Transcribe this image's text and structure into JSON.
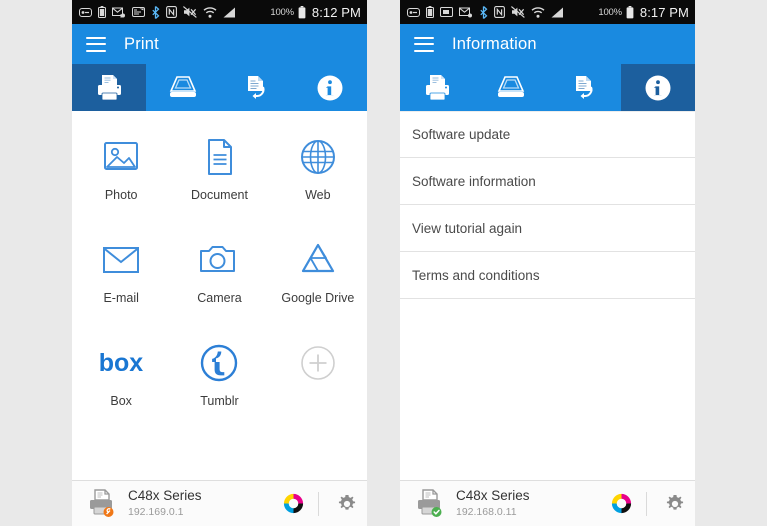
{
  "theme": {
    "accent": "#1a8ae0",
    "accent_dark": "#1c5f9e",
    "icon_blue": "#3f8ddb",
    "status_bg": "#0a0a0a",
    "page_bg": "#e9e9e9",
    "text_primary": "#3c3c3c",
    "text_secondary": "#9a9a9a",
    "ok_green": "#4caf50",
    "warn_orange": "#f07818"
  },
  "left_phone": {
    "status_bar": {
      "icons": [
        "sim-card-icon",
        "battery-saving-icon",
        "mail-sync-icon",
        "sd-card-icon",
        "bluetooth-icon",
        "nfc-icon",
        "mute-icon",
        "wifi-icon",
        "signal-icon"
      ],
      "battery_percent": "100%",
      "battery_icon": "battery-full-icon",
      "time": "8:12 PM"
    },
    "app_bar": {
      "menu_icon": "hamburger-menu-icon",
      "title": "Print"
    },
    "tabs": [
      {
        "name": "print",
        "icon": "printer-icon",
        "active": true
      },
      {
        "name": "scan",
        "icon": "scanner-icon",
        "active": false
      },
      {
        "name": "fax",
        "icon": "fax-document-icon",
        "active": false
      },
      {
        "name": "information",
        "icon": "info-circle-icon",
        "active": false
      }
    ],
    "sources": [
      {
        "label": "Photo",
        "icon": "photo-icon"
      },
      {
        "label": "Document",
        "icon": "document-icon"
      },
      {
        "label": "Web",
        "icon": "globe-icon"
      },
      {
        "label": "E-mail",
        "icon": "envelope-icon"
      },
      {
        "label": "Camera",
        "icon": "camera-icon"
      },
      {
        "label": "Google Drive",
        "icon": "google-drive-icon"
      },
      {
        "label": "Box",
        "icon": "box-logo-icon"
      },
      {
        "label": "Tumblr",
        "icon": "tumblr-logo-icon"
      },
      {
        "label": "",
        "icon": "add-plus-icon"
      }
    ],
    "bottom_bar": {
      "printer_icon": "printer-status-icon",
      "status_badge": "warning-wrench-badge",
      "printer_name": "C48x Series",
      "printer_ip": "192.169.0.1",
      "supplies_icon": "cmyk-color-wheel-icon",
      "settings_icon": "gear-icon"
    }
  },
  "right_phone": {
    "status_bar": {
      "icons": [
        "sim-card-icon",
        "battery-saving-icon",
        "screenshot-icon",
        "mail-sync-icon",
        "bluetooth-icon",
        "nfc-icon",
        "mute-icon",
        "wifi-icon",
        "signal-icon"
      ],
      "battery_percent": "100%",
      "battery_icon": "battery-full-icon",
      "time": "8:17 PM"
    },
    "app_bar": {
      "menu_icon": "hamburger-menu-icon",
      "title": "Information"
    },
    "tabs": [
      {
        "name": "print",
        "icon": "printer-icon",
        "active": false
      },
      {
        "name": "scan",
        "icon": "scanner-icon",
        "active": false
      },
      {
        "name": "fax",
        "icon": "fax-document-icon",
        "active": false
      },
      {
        "name": "information",
        "icon": "info-circle-icon",
        "active": true
      }
    ],
    "menu_items": [
      {
        "label": "Software update"
      },
      {
        "label": "Software information"
      },
      {
        "label": "View tutorial again"
      },
      {
        "label": "Terms and conditions"
      }
    ],
    "bottom_bar": {
      "printer_icon": "printer-status-icon",
      "status_badge": "connected-check-badge",
      "printer_name": "C48x Series",
      "printer_ip": "192.168.0.11",
      "supplies_icon": "cmyk-color-wheel-icon",
      "settings_icon": "gear-icon"
    }
  }
}
